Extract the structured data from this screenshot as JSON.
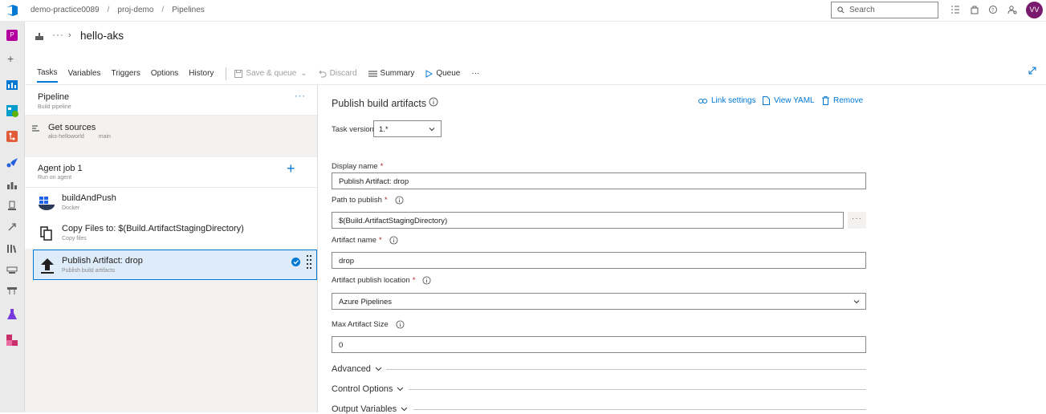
{
  "breadcrumb": {
    "org": "demo-practice0089",
    "project": "proj-demo",
    "section": "Pipelines"
  },
  "search": {
    "placeholder": "Search"
  },
  "user": {
    "initials": "VV"
  },
  "project_badge": "P",
  "header": {
    "title": "hello-aks"
  },
  "tabs": [
    {
      "label": "Tasks",
      "active": true
    },
    {
      "label": "Variables"
    },
    {
      "label": "Triggers"
    },
    {
      "label": "Options"
    },
    {
      "label": "History"
    }
  ],
  "toolbar": {
    "save_queue": "Save & queue",
    "discard": "Discard",
    "summary": "Summary",
    "queue": "Queue"
  },
  "pipeline": {
    "title": "Pipeline",
    "subtitle": "Build pipeline"
  },
  "get_sources": {
    "title": "Get sources",
    "repo": "aks-helloworld",
    "branch": "main"
  },
  "agent_job": {
    "title": "Agent job 1",
    "subtitle": "Run on agent"
  },
  "tasks": [
    {
      "title": "buildAndPush",
      "subtitle": "Docker"
    },
    {
      "title": "Copy Files to: $(Build.ArtifactStagingDirectory)",
      "subtitle": "Copy files"
    },
    {
      "title": "Publish Artifact: drop",
      "subtitle": "Publish build artifacts",
      "selected": true
    }
  ],
  "detail": {
    "title": "Publish build artifacts",
    "actions": {
      "link_settings": "Link settings",
      "view_yaml": "View YAML",
      "remove": "Remove"
    },
    "task_version_label": "Task version",
    "task_version_value": "1.*",
    "display_name_label": "Display name",
    "display_name_value": "Publish Artifact: drop",
    "path_label": "Path to publish",
    "path_value": "$(Build.ArtifactStagingDirectory)",
    "artifact_name_label": "Artifact name",
    "artifact_name_value": "drop",
    "publish_location_label": "Artifact publish location",
    "publish_location_value": "Azure Pipelines",
    "max_size_label": "Max Artifact Size",
    "max_size_value": "0",
    "required_mark": "*",
    "sections": [
      "Advanced",
      "Control Options",
      "Output Variables"
    ]
  },
  "colors": {
    "accent": "#0078d4",
    "selected_bg": "#deecf9",
    "avatar": "#7a1a6f",
    "project_badge": "#b4009e"
  }
}
